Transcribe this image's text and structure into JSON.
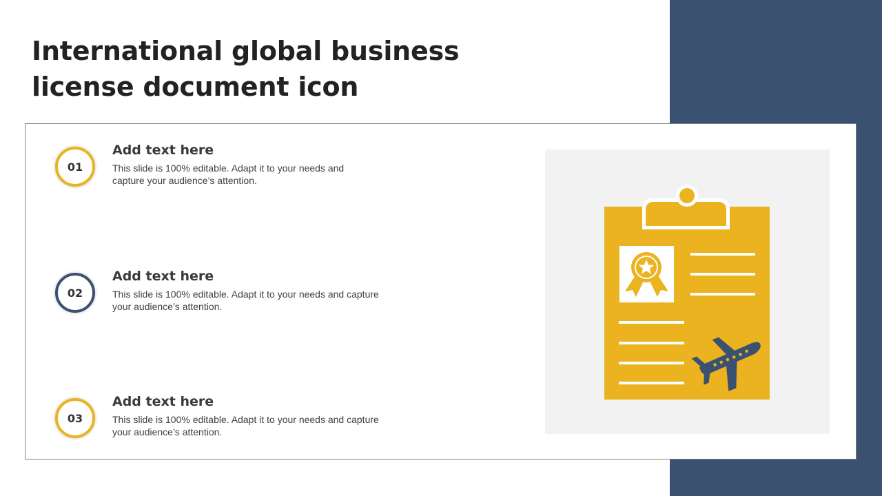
{
  "slide": {
    "title_line1": "International global business",
    "title_line2": "license document icon"
  },
  "items": [
    {
      "number": "01",
      "heading": "Add text here",
      "desc_line1": "This slide is 100% editable. Adapt it to your needs and",
      "desc_line2": "capture your audience’s attention."
    },
    {
      "number": "02",
      "heading": "Add text here",
      "desc_line1": "This slide is 100% editable. Adapt it to your needs and capture",
      "desc_line2": "your audience’s attention."
    },
    {
      "number": "03",
      "heading": "Add text here",
      "desc_line1": "This slide is 100% editable. Adapt it to your needs and capture",
      "desc_line2": "your audience’s attention."
    }
  ],
  "icon": {
    "name": "clipboard-license-airplane-icon",
    "badge_icon": "award-ribbon-star-icon",
    "plane_icon": "airplane-icon"
  },
  "colors": {
    "accent_yellow": "#ebb31f",
    "accent_navy": "#3a5172",
    "panel_gray": "#f2f2f2",
    "text_dark": "#222222"
  }
}
